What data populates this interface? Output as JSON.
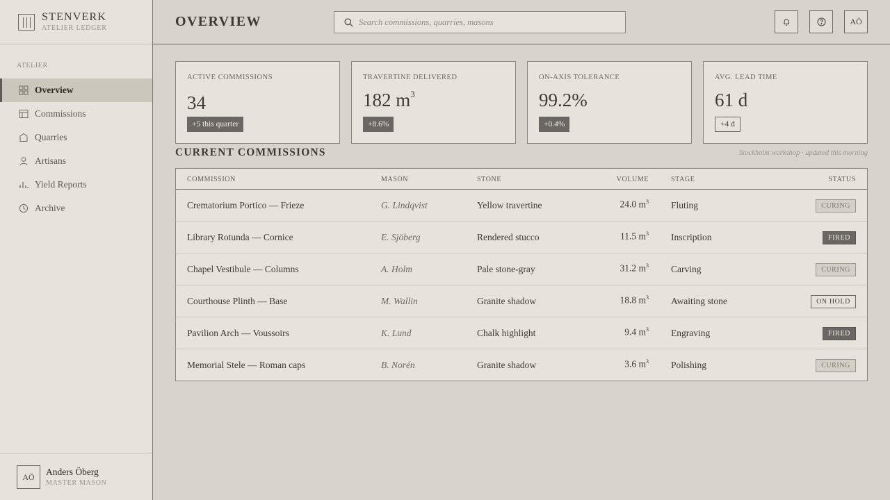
{
  "brand": {
    "name": "STENVERK",
    "sub": "ATELIER LEDGER"
  },
  "sidebar": {
    "section_label": "ATELIER",
    "items": [
      {
        "label": "Overview",
        "icon": "grid-icon",
        "active": true
      },
      {
        "label": "Commissions",
        "icon": "layout-icon"
      },
      {
        "label": "Quarries",
        "icon": "stone-icon"
      },
      {
        "label": "Artisans",
        "icon": "person-icon"
      },
      {
        "label": "Yield Reports",
        "icon": "bar-chart-icon"
      },
      {
        "label": "Archive",
        "icon": "clock-icon"
      }
    ]
  },
  "user": {
    "initials": "AÖ",
    "name": "Anders Öberg",
    "role": "MASTER MASON"
  },
  "header": {
    "title": "OVERVIEW",
    "search_placeholder": "Search commissions, quarries, masons",
    "avatar_initials": "AÖ"
  },
  "kpis": [
    {
      "label": "ACTIVE COMMISSIONS",
      "value": "34",
      "unit_sup": "",
      "badge": "+5 this quarter",
      "badge_style": "filled"
    },
    {
      "label": "TRAVERTINE DELIVERED",
      "value": "182 m",
      "unit_sup": "3",
      "badge": "+8.6%",
      "badge_style": "filled"
    },
    {
      "label": "ON-AXIS TOLERANCE",
      "value": "99.2%",
      "unit_sup": "",
      "badge": "+0.4%",
      "badge_style": "filled"
    },
    {
      "label": "AVG. LEAD TIME",
      "value": "61 d",
      "unit_sup": "",
      "badge": "+4 d",
      "badge_style": "outline"
    }
  ],
  "commissions": {
    "title": "CURRENT COMMISSIONS",
    "note": "Stockholm workshop · updated this morning",
    "columns": {
      "commission": "COMMISSION",
      "mason": "MASON",
      "stone": "STONE",
      "volume": "VOLUME",
      "stage": "STAGE",
      "status": "STATUS"
    },
    "rows": [
      {
        "commission": "Crematorium Portico — Frieze",
        "mason": "G. Lindqvist",
        "stone": "Yellow travertine",
        "volume": "24.0 m",
        "volume_sup": "3",
        "stage": "Fluting",
        "status": "CURING",
        "status_style": "curing"
      },
      {
        "commission": "Library Rotunda — Cornice",
        "mason": "E. Sjöberg",
        "stone": "Rendered stucco",
        "volume": "11.5 m",
        "volume_sup": "3",
        "stage": "Inscription",
        "status": "FIRED",
        "status_style": "fired"
      },
      {
        "commission": "Chapel Vestibule — Columns",
        "mason": "A. Holm",
        "stone": "Pale stone-gray",
        "volume": "31.2 m",
        "volume_sup": "3",
        "stage": "Carving",
        "status": "CURING",
        "status_style": "curing"
      },
      {
        "commission": "Courthouse Plinth — Base",
        "mason": "M. Wallin",
        "stone": "Granite shadow",
        "volume": "18.8 m",
        "volume_sup": "3",
        "stage": "Awaiting stone",
        "status": "ON HOLD",
        "status_style": "hold"
      },
      {
        "commission": "Pavilion Arch — Voussoirs",
        "mason": "K. Lund",
        "stone": "Chalk highlight",
        "volume": "9.4 m",
        "volume_sup": "3",
        "stage": "Engraving",
        "status": "FIRED",
        "status_style": "fired"
      },
      {
        "commission": "Memorial Stele — Roman caps",
        "mason": "B. Norén",
        "stone": "Granite shadow",
        "volume": "3.6 m",
        "volume_sup": "3",
        "stage": "Polishing",
        "status": "CURING",
        "status_style": "curing"
      }
    ]
  }
}
